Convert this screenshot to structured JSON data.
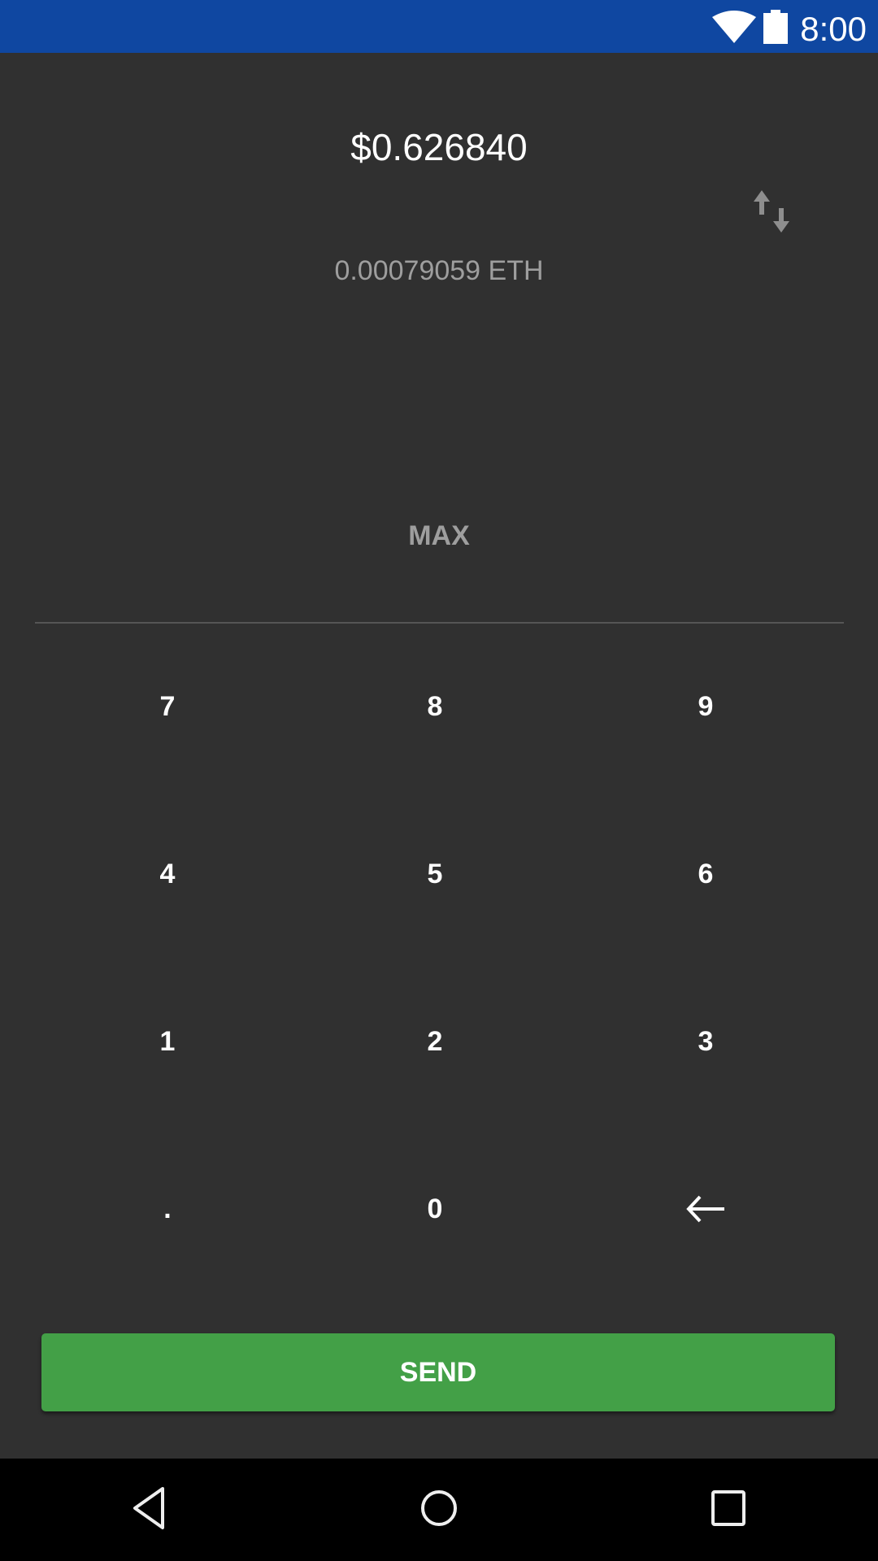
{
  "status_bar": {
    "time": "8:00",
    "icons": [
      "wifi-icon",
      "battery-icon"
    ]
  },
  "amount": {
    "fiat": "$0.626840",
    "crypto": "0.00079059 ETH"
  },
  "max_label": "MAX",
  "keypad": [
    "7",
    "8",
    "9",
    "4",
    "5",
    "6",
    "1",
    "2",
    "3",
    ".",
    "0"
  ],
  "backspace_icon": "arrow-left-icon",
  "send_label": "SEND",
  "colors": {
    "status_bar": "#0f47a1",
    "background": "#303030",
    "send": "#43a047"
  }
}
